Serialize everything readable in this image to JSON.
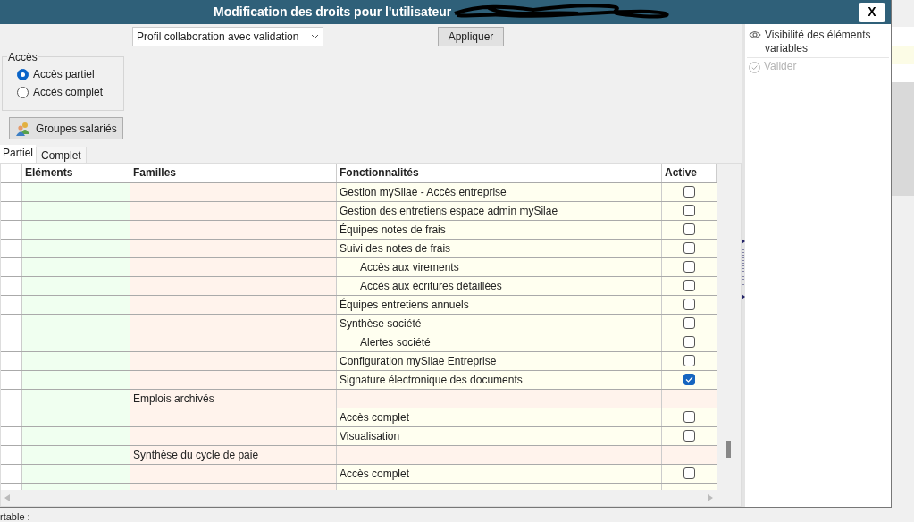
{
  "window": {
    "title": "Modification des droits pour l'utilisateur",
    "close": "X"
  },
  "profile_select": {
    "value": "Profil collaboration avec validation"
  },
  "apply_button": "Appliquer",
  "access": {
    "label": "Accès",
    "options": [
      {
        "label": "Accès partiel",
        "selected": true
      },
      {
        "label": "Accès complet",
        "selected": false
      }
    ]
  },
  "groups_button": "Groupes salariés",
  "tabs": [
    {
      "label": "Partiel",
      "selected": true
    },
    {
      "label": "Complet",
      "selected": false
    }
  ],
  "table": {
    "columns": [
      "Eléments",
      "Familles",
      "Fonctionnalités",
      "Active"
    ],
    "rows": [
      {
        "kind": "function",
        "label": "Gestion mySilae - Accès entreprise",
        "checked": false
      },
      {
        "kind": "function",
        "label": "Gestion des entretiens espace admin mySilae",
        "checked": false
      },
      {
        "kind": "function",
        "label": "Équipes notes de frais",
        "checked": false
      },
      {
        "kind": "function",
        "label": "Suivi des notes de frais",
        "checked": false,
        "children": [
          {
            "kind": "function",
            "label": "Accès aux virements",
            "checked": false
          },
          {
            "kind": "function",
            "label": "Accès aux écritures détaillées",
            "checked": false
          }
        ]
      },
      {
        "kind": "function",
        "label": "Équipes entretiens annuels",
        "checked": false
      },
      {
        "kind": "function",
        "label": "Synthèse société",
        "checked": false,
        "children": [
          {
            "kind": "function",
            "label": "Alertes société",
            "checked": false
          }
        ]
      },
      {
        "kind": "function",
        "label": "Configuration mySilae Entreprise",
        "checked": false
      },
      {
        "kind": "function",
        "label": "Signature électronique des documents",
        "checked": true
      },
      {
        "kind": "family",
        "label": "Emplois archivés"
      },
      {
        "kind": "function",
        "label": "Accès complet",
        "checked": false
      },
      {
        "kind": "function",
        "label": "Visualisation",
        "checked": false
      },
      {
        "kind": "family",
        "label": "Synthèse du cycle de paie"
      },
      {
        "kind": "function",
        "label": "Accès complet",
        "checked": false
      }
    ]
  },
  "side_panel": {
    "items": [
      {
        "kind": "eye",
        "label": "Visibilité des éléments variables",
        "disabled": false
      },
      {
        "kind": "check",
        "label": "Valider",
        "disabled": true
      }
    ]
  },
  "background": {
    "label": "rtable :"
  }
}
